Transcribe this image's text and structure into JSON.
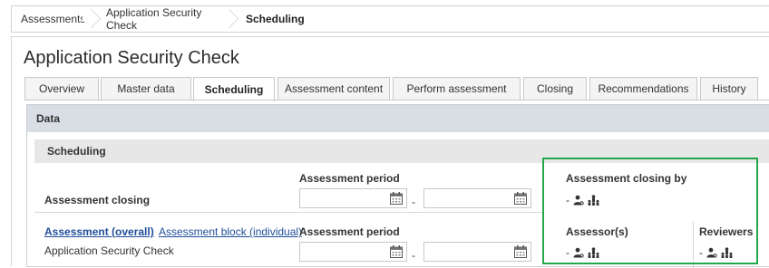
{
  "breadcrumb": [
    "Assessments",
    "Application Security Check",
    "Scheduling"
  ],
  "page_title": "Application Security Check",
  "tabs": [
    {
      "label": "Overview",
      "active": false
    },
    {
      "label": "Master data",
      "active": false
    },
    {
      "label": "Scheduling",
      "active": true
    },
    {
      "label": "Assessment content",
      "active": false
    },
    {
      "label": "Perform assessment",
      "active": false
    },
    {
      "label": "Closing",
      "active": false
    },
    {
      "label": "Recommendations",
      "active": false
    },
    {
      "label": "History",
      "active": false
    }
  ],
  "data_section": {
    "title": "Data",
    "scheduling_title": "Scheduling",
    "row1": {
      "label": "Assessment closing",
      "period_label": "Assessment period",
      "from_value": "",
      "to_value": "",
      "closing_by_label": "Assessment closing by",
      "closing_by_value": "-"
    },
    "row2": {
      "link_overall": "Assessment (overall)",
      "link_block": "Assessment block (individual)",
      "name": "Application Security Check",
      "period_label": "Assessment period",
      "from_value": "",
      "to_value": "",
      "assessors_label": "Assessor(s)",
      "assessors_value": "-",
      "reviewers_label": "Reviewers",
      "reviewers_value": "-"
    },
    "date_separator": "-"
  },
  "icons": {
    "calendar": "calendar-icon",
    "person": "person-search-icon",
    "org": "org-chart-icon"
  },
  "colors": {
    "highlight": "#22a84a",
    "link": "#1f4e9a",
    "data_header_bg": "#d9dee4"
  }
}
